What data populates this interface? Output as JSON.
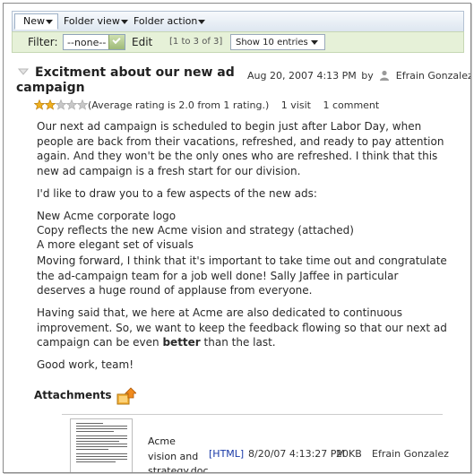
{
  "toolbar": {
    "new_label": "New",
    "folder_view_label": "Folder view",
    "folder_action_label": "Folder action"
  },
  "filter": {
    "label": "Filter:",
    "selected": "--none--",
    "edit_label": "Edit",
    "count_text": "[1 to 3 of 3]",
    "show_label": "Show 10 entries"
  },
  "post": {
    "title": "Excitment about our new ad campaign",
    "date": "Aug 20, 2007 4:13 PM",
    "by": "by",
    "author": "Efrain Gonzalez",
    "rating": 2.0,
    "rating_max": 5,
    "rating_text": "(Average rating is 2.0 from 1 rating.)",
    "visits": "1 visit",
    "comments": "1 comment",
    "paragraph1": "Our next ad campaign is scheduled to begin just after Labor Day, when people are back from their vacations, refreshed, and ready to pay attention again. And they won't be the only ones who are refreshed. I think that this new ad campaign is a fresh start for our division.",
    "paragraph2": "I'd like to draw you to a few aspects of the new ads:",
    "list_items": [
      "New Acme corporate logo",
      "Copy reflects the new Acme vision and strategy (attached)",
      "A more elegant set of visuals"
    ],
    "paragraph4": "Moving forward, I think that it's important to take time out and congratulate the ad-campaign team for a job well done! Sally Jaffee in particular deserves a huge round of applause from everyone.",
    "paragraph5_before": "Having said that, we here at Acme are also dedicated to continuous improvement. So, we want to keep the feedback flowing so that our next ad campaign can be even ",
    "paragraph5_bold": "better",
    "paragraph5_after": " than the last.",
    "paragraph6": "Good work, team!"
  },
  "attachments": {
    "heading": "Attachments",
    "items": [
      {
        "name": "Acme vision and strategy.doc",
        "html_link": "[HTML]",
        "date": "8/20/07 4:13:27 PM",
        "size": "20KB",
        "author": "Efrain Gonzalez"
      }
    ]
  },
  "icons": {
    "collapse": "collapse-triangle-icon",
    "user": "user-icon",
    "star": "star-icon",
    "attachment": "attachment-folder-icon",
    "dropdown": "chevron-down-icon"
  },
  "colors": {
    "filter_bar_bg": "#e6f1d8",
    "menubar_bg": "#dde6f0",
    "star_filled": "#f0b020",
    "star_empty": "#c8c8c8",
    "link": "#1a3aa8"
  }
}
